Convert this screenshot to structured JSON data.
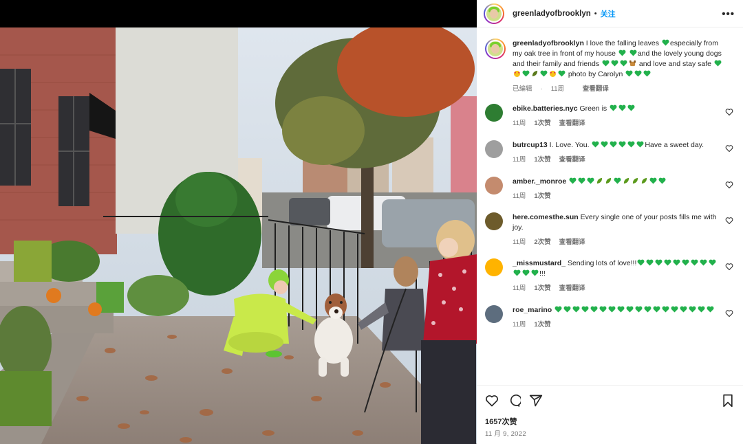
{
  "header": {
    "username": "greenladyofbrooklyn",
    "separator": "•",
    "follow_label": "关注",
    "more_label": "•••"
  },
  "caption": {
    "username": "greenladyofbrooklyn",
    "text_1": " I love the falling leaves ",
    "text_2": "especially from my oak tree in front of my house ",
    "text_3": "and the lovely young dogs and their family and friends ",
    "text_4": " and love and stay safe ",
    "text_5": " photo by Carolyn ",
    "edited": "已编辑",
    "dot": "·",
    "time": "11周",
    "translate": "查看翻译"
  },
  "comments": [
    {
      "username": "ebike.batteries.nyc",
      "text": " Green is ",
      "hearts": 3,
      "time": "11周",
      "likes": "1次赞",
      "translate": "查看翻译",
      "avatar_color": "#2e7d32"
    },
    {
      "username": "butrcup13",
      "text": " I. Love. You. ",
      "text_after": "Have a sweet day.",
      "hearts": 6,
      "time": "11周",
      "likes": "1次赞",
      "translate": "查看翻译",
      "avatar_color": "#9e9e9e"
    },
    {
      "username": "amber._monroe",
      "text": " ",
      "hearts": 11,
      "time": "11周",
      "likes": "1次赞",
      "translate": "",
      "avatar_color": "#c48b6e"
    },
    {
      "username": "here.comesthe.sun",
      "text": " Every single one of your posts fills me with joy.",
      "hearts": 0,
      "time": "11周",
      "likes": "2次赞",
      "translate": "查看翻译",
      "avatar_color": "#6d5b2b"
    },
    {
      "username": "_missmustard_",
      "text": " Sending lots of love!!!",
      "text_after": "!!!",
      "hearts": 12,
      "time": "11周",
      "likes": "1次赞",
      "translate": "查看翻译",
      "avatar_color": "#ffb300"
    },
    {
      "username": "roe_marino",
      "text": " ",
      "hearts": 18,
      "time": "11周",
      "likes": "1次赞",
      "translate": "",
      "avatar_color": "#5d6d7e"
    }
  ],
  "footer": {
    "likes": "1657次赞",
    "date": "11 月 9, 2022"
  },
  "icons": [
    "heart-icon",
    "comment-icon",
    "share-icon",
    "bookmark-icon",
    "more-icon"
  ],
  "colors": {
    "accent": "#0095f6",
    "green_heart": "#22b14c",
    "text": "#262626",
    "muted": "#737373"
  }
}
